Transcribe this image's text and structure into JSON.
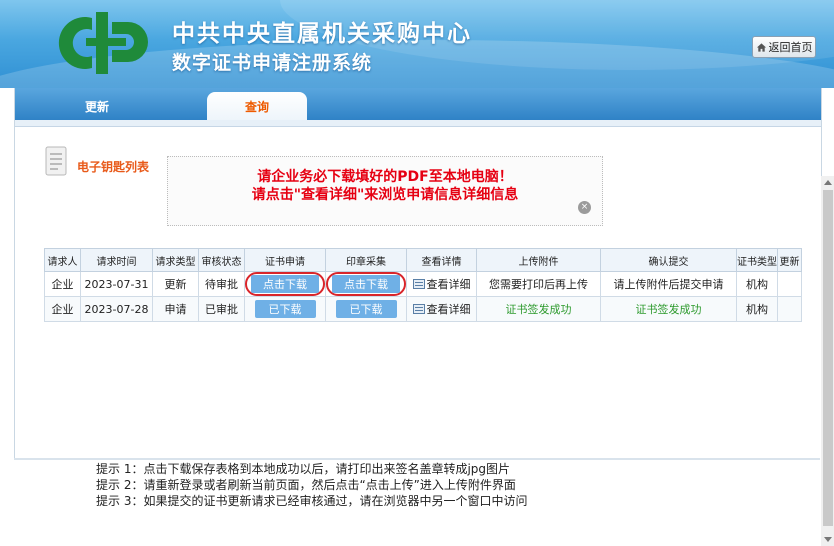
{
  "header": {
    "org_title": "中共中央直属机关采购中心",
    "system_title": "数字证书申请注册系统",
    "home_button": "返回首页",
    "colors": {
      "banner": "#3d9cdc",
      "logo": "#1f8a3a"
    }
  },
  "tabs": [
    {
      "label": "更新"
    },
    {
      "label": "查询"
    }
  ],
  "section": {
    "title": "电子钥匙列表",
    "notice_line1": "请企业务必下载填好的PDF至本地电脑！",
    "notice_line2": "请点击\"查看详细\"来浏览申请信息详细信息",
    "close_icon": "×"
  },
  "table": {
    "headers": [
      "请求人",
      "请求时间",
      "请求类型",
      "审核状态",
      "证书申请",
      "印章采集",
      "查看详情",
      "上传附件",
      "确认提交",
      "证书类型",
      "更新"
    ],
    "rows": [
      {
        "requester": "企业",
        "time": "2023-07-31",
        "type": "更新",
        "status": "待审批",
        "cert": "点击下载",
        "seal": "点击下载",
        "detail": "查看详细",
        "upload": "您需要打印后再上传",
        "confirm": "请上传附件后提交申请",
        "cert_type": "机构",
        "update": ""
      },
      {
        "requester": "企业",
        "time": "2023-07-28",
        "type": "申请",
        "status": "已审批",
        "cert": "已下载",
        "seal": "已下载",
        "detail": "查看详细",
        "upload": "证书签发成功",
        "confirm": "证书签发成功",
        "cert_type": "机构",
        "update": ""
      }
    ]
  },
  "tips": {
    "line1": "提示 1：点击下载保存表格到本地成功以后，请打印出来签名盖章转成jpg图片",
    "line2": "提示 2：请重新登录或者刷新当前页面，然后点击“点击上传”进入上传附件界面",
    "line3": "提示 3：如果提交的证书更新请求已经审核通过，请在浏览器中另一个窗口中访问"
  }
}
